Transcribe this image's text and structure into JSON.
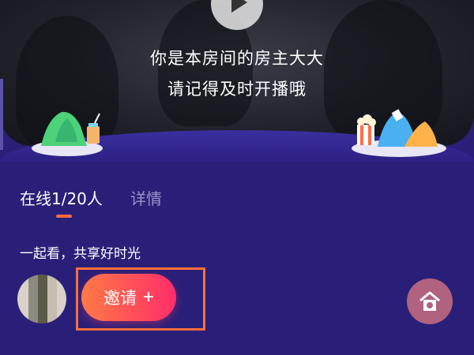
{
  "video": {
    "line1": "你是本房间的房主大大",
    "line2": "请记得及时开播哦"
  },
  "tabs": {
    "online": "在线1/20人",
    "details": "详情"
  },
  "tagline": "一起看，共享好时光",
  "invite": {
    "label": "邀请",
    "plus": "+"
  },
  "colors": {
    "background": "#2a1f78",
    "accent": "#ff6a3d",
    "invite_gradient_start": "#ff7a45",
    "invite_gradient_end": "#ff2d6a"
  },
  "icons": [
    "play-icon",
    "plus-icon",
    "home-icon",
    "decor-mountain-drink",
    "decor-mountain-popcorn"
  ]
}
